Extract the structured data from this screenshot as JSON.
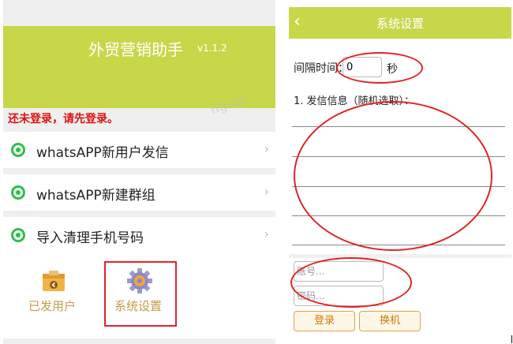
{
  "app": {
    "title": "外贸营销助手",
    "version": "v1.1.2"
  },
  "login_warning": "还未登录，请先登录。",
  "menu": [
    {
      "label": "whatsAPP新用户发信",
      "icon": "whatsapp-icon"
    },
    {
      "label": "whatsAPP新建群组",
      "icon": "whatsapp-icon"
    },
    {
      "label": "导入清理手机号码",
      "icon": "whatsapp-icon"
    }
  ],
  "bottom_tiles": [
    {
      "label": "已发用户",
      "icon": "box-icon"
    },
    {
      "label": "系统设置",
      "icon": "gear-icon"
    }
  ],
  "settings": {
    "title": "系统设置",
    "back_icon": "chevron-left-icon",
    "interval_label": "间隔时间：",
    "interval_value": "0",
    "interval_unit": "秒",
    "message_label": "1. 发信信息（随机选取）：",
    "account_placeholder": "账号...",
    "password_placeholder": "密码...",
    "login_button": "登录",
    "switch_button": "换机"
  },
  "colors": {
    "header": "#c8d64a",
    "warning": "#e01010",
    "annotation": "#e02424",
    "tile_text": "#c89a47",
    "button_text": "#d07a10"
  }
}
